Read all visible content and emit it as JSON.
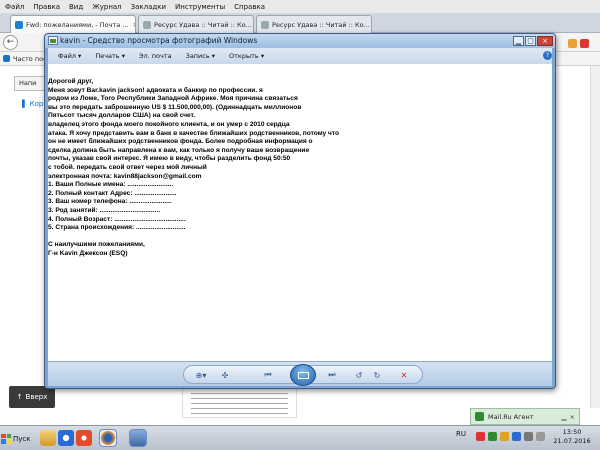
{
  "browser": {
    "menu": [
      "Файл",
      "Правка",
      "Вид",
      "Журнал",
      "Закладки",
      "Инструменты",
      "Справка"
    ],
    "tabs": [
      {
        "label": "Fwd: пожеланиями, - Почта ..."
      },
      {
        "label": "Ресурс Удава :: Читай :: Ко..."
      },
      {
        "label": "Ресурс Удава :: Читай :: Ко..."
      }
    ],
    "bookmark": "Часто посе",
    "mail_button": "Напи",
    "side_link": "Кор",
    "up_button": "Вверх",
    "agent_label": "Mail.Ru Агент"
  },
  "viewer": {
    "title": "kavin - Средство просмотра фотографий Windows",
    "menu": [
      "Файл",
      "Печать",
      "Эл. почта",
      "Запись",
      "Открыть"
    ],
    "letter_lines": [
      "Дорогой друг,",
      "Меня зовут Bar.kavin jackson! адвоката и банкир по профессии. я",
      "родом из Ломе, Того Республики Западной Африке. Моя причина связаться",
      "вы это передать заброшенную US $ 11.500,000,00). (Одиннадцать миллионов",
      "Пятьсот тысяч долларов США) на свой счет.",
      "владелец этого фонда моего покойного клиента, и он умер с 2010 сердца",
      "атака. Я хочу представить вам в банк в качестве ближайших родственников, потому что",
      "он не имеет ближайших родственников фонда. Более подробная информация о",
      "сделка должна быть направлена к вам, как только я получу ваше возвращение",
      "почты, указав свой интерес. Я имею в виду, чтобы разделить фонд 50:50",
      "с тобой. передать свой ответ через мой личный",
      "электронная почта: kavin88jackson@gmail.com",
      "1. Ваши Полные имена: .........................",
      "2. Полный контакт Адрес: .......................",
      "3. Ваш номер телефона: .......................",
      "3. Род занятий: .................................",
      "4. Полный Возраст: .......................................",
      "5. Страна происхождения: ...........................",
      "",
      "С наилучшими пожеланиями,",
      "Г-н Kavin Джексон (ESQ)"
    ]
  },
  "taskbar": {
    "start_label": "Пуск",
    "lang": "RU",
    "time": "13:50",
    "date": "21.07.2016"
  }
}
